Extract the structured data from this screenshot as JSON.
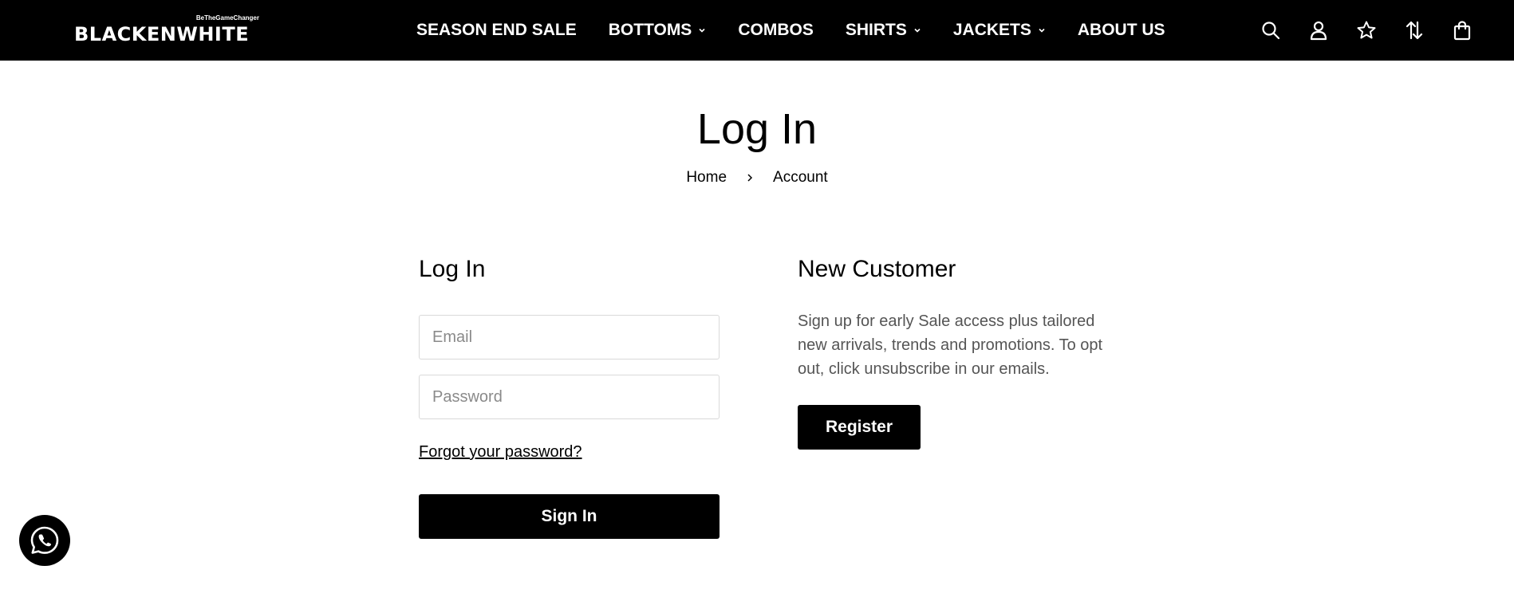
{
  "brand": {
    "tagline": "BeTheGameChanger",
    "name": "BLACKENWHITE"
  },
  "nav": [
    {
      "label": "SEASON END SALE",
      "has_dropdown": false
    },
    {
      "label": "BOTTOMS",
      "has_dropdown": true
    },
    {
      "label": "COMBOS",
      "has_dropdown": false
    },
    {
      "label": "SHIRTS",
      "has_dropdown": true
    },
    {
      "label": "JACKETS",
      "has_dropdown": true
    },
    {
      "label": "ABOUT US",
      "has_dropdown": false
    }
  ],
  "header_icons": [
    "search-icon",
    "account-icon",
    "wishlist-star-icon",
    "sort-arrows-icon",
    "shopping-bag-icon"
  ],
  "page": {
    "title": "Log In",
    "breadcrumb": {
      "home": "Home",
      "current": "Account"
    }
  },
  "login": {
    "title": "Log In",
    "email_placeholder": "Email",
    "password_placeholder": "Password",
    "forgot_label": "Forgot your password?",
    "submit_label": "Sign In"
  },
  "new_customer": {
    "title": "New Customer",
    "text": "Sign up for early Sale access plus tailored new arrivals, trends and promotions. To opt out, click unsubscribe in our emails.",
    "register_label": "Register"
  },
  "colors": {
    "header_bg": "#000000",
    "button_bg": "#000000",
    "muted_text": "#555555"
  }
}
